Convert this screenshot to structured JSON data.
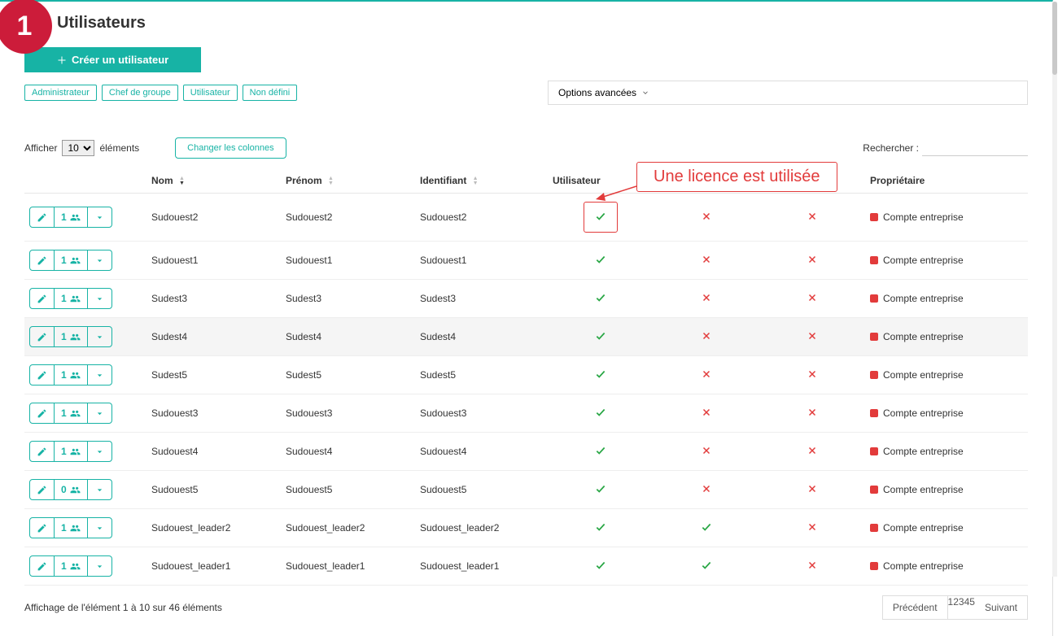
{
  "badge_number": "1",
  "page_title": "Utilisateurs",
  "create_button": "Créer un utilisateur",
  "filters": [
    "Administrateur",
    "Chef de groupe",
    "Utilisateur",
    "Non défini"
  ],
  "advanced_options": "Options avancées",
  "show_label_pre": "Afficher",
  "show_label_post": "éléments",
  "page_length": "10",
  "change_columns": "Changer les colonnes",
  "search_label": "Rechercher :",
  "columns": {
    "nom": "Nom",
    "prenom": "Prénom",
    "identifiant": "Identifiant",
    "utilisateur": "Utilisateur",
    "proprietaire": "Propriétaire"
  },
  "callout_text": "Une licence est utilisée",
  "rows": [
    {
      "count": "1",
      "nom": "Sudouest2",
      "prenom": "Sudouest2",
      "ident": "Sudouest2",
      "u": true,
      "c1": false,
      "c2": false,
      "owner": "Compte entreprise",
      "hl": false,
      "boxed": true
    },
    {
      "count": "1",
      "nom": "Sudouest1",
      "prenom": "Sudouest1",
      "ident": "Sudouest1",
      "u": true,
      "c1": false,
      "c2": false,
      "owner": "Compte entreprise",
      "hl": false,
      "boxed": false
    },
    {
      "count": "1",
      "nom": "Sudest3",
      "prenom": "Sudest3",
      "ident": "Sudest3",
      "u": true,
      "c1": false,
      "c2": false,
      "owner": "Compte entreprise",
      "hl": false,
      "boxed": false
    },
    {
      "count": "1",
      "nom": "Sudest4",
      "prenom": "Sudest4",
      "ident": "Sudest4",
      "u": true,
      "c1": false,
      "c2": false,
      "owner": "Compte entreprise",
      "hl": true,
      "boxed": false
    },
    {
      "count": "1",
      "nom": "Sudest5",
      "prenom": "Sudest5",
      "ident": "Sudest5",
      "u": true,
      "c1": false,
      "c2": false,
      "owner": "Compte entreprise",
      "hl": false,
      "boxed": false
    },
    {
      "count": "1",
      "nom": "Sudouest3",
      "prenom": "Sudouest3",
      "ident": "Sudouest3",
      "u": true,
      "c1": false,
      "c2": false,
      "owner": "Compte entreprise",
      "hl": false,
      "boxed": false
    },
    {
      "count": "1",
      "nom": "Sudouest4",
      "prenom": "Sudouest4",
      "ident": "Sudouest4",
      "u": true,
      "c1": false,
      "c2": false,
      "owner": "Compte entreprise",
      "hl": false,
      "boxed": false
    },
    {
      "count": "0",
      "nom": "Sudouest5",
      "prenom": "Sudouest5",
      "ident": "Sudouest5",
      "u": true,
      "c1": false,
      "c2": false,
      "owner": "Compte entreprise",
      "hl": false,
      "boxed": false
    },
    {
      "count": "1",
      "nom": "Sudouest_leader2",
      "prenom": "Sudouest_leader2",
      "ident": "Sudouest_leader2",
      "u": true,
      "c1": true,
      "c2": false,
      "owner": "Compte entreprise",
      "hl": false,
      "boxed": false
    },
    {
      "count": "1",
      "nom": "Sudouest_leader1",
      "prenom": "Sudouest_leader1",
      "ident": "Sudouest_leader1",
      "u": true,
      "c1": true,
      "c2": false,
      "owner": "Compte entreprise",
      "hl": false,
      "boxed": false
    }
  ],
  "footer_info": "Affichage de l'élément 1 à 10 sur 46 éléments",
  "pagination": {
    "prev": "Précédent",
    "pages": [
      "1",
      "2",
      "3",
      "4",
      "5"
    ],
    "active": "1",
    "next": "Suivant"
  }
}
